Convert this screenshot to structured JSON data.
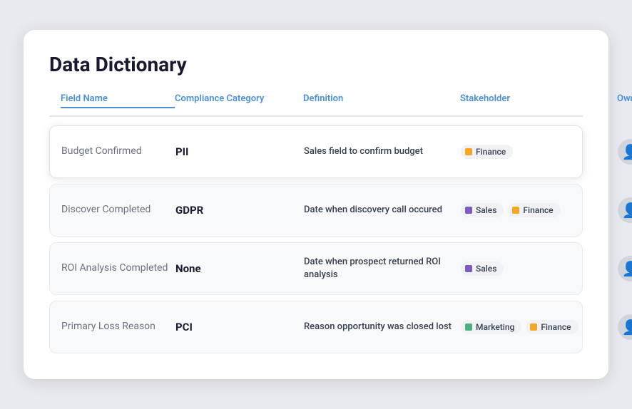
{
  "page": {
    "title": "Data Dictionary"
  },
  "table": {
    "headers": [
      {
        "key": "field_name",
        "label": "Field Name",
        "active": true
      },
      {
        "key": "compliance_category",
        "label": "Compliance Category",
        "active": false
      },
      {
        "key": "definition",
        "label": "Definition",
        "active": false
      },
      {
        "key": "stakeholder",
        "label": "Stakeholder",
        "active": false
      },
      {
        "key": "owner",
        "label": "Owner",
        "active": false
      }
    ],
    "rows": [
      {
        "id": "budget-confirmed",
        "highlighted": true,
        "field_name": "Budget Confirmed",
        "compliance": "PII",
        "definition": "Sales field to confirm budget",
        "stakeholders": [
          {
            "label": "Finance",
            "color": "#f5a623"
          }
        ]
      },
      {
        "id": "discover-completed",
        "highlighted": false,
        "field_name": "Discover Completed",
        "compliance": "GDPR",
        "definition": "Date when discovery call occured",
        "stakeholders": [
          {
            "label": "Sales",
            "color": "#7c5cbf"
          },
          {
            "label": "Finance",
            "color": "#f5a623"
          }
        ]
      },
      {
        "id": "roi-analysis-completed",
        "highlighted": false,
        "field_name": "ROI Analysis Completed",
        "compliance": "None",
        "definition": "Date when prospect returned ROI analysis",
        "stakeholders": [
          {
            "label": "Sales",
            "color": "#7c5cbf"
          }
        ]
      },
      {
        "id": "primary-loss-reason",
        "highlighted": false,
        "field_name": "Primary Loss Reason",
        "compliance": "PCI",
        "definition": "Reason opportunity was closed lost",
        "stakeholders": [
          {
            "label": "Marketing",
            "color": "#4caf7d"
          },
          {
            "label": "Finance",
            "color": "#f5a623"
          }
        ]
      }
    ]
  }
}
